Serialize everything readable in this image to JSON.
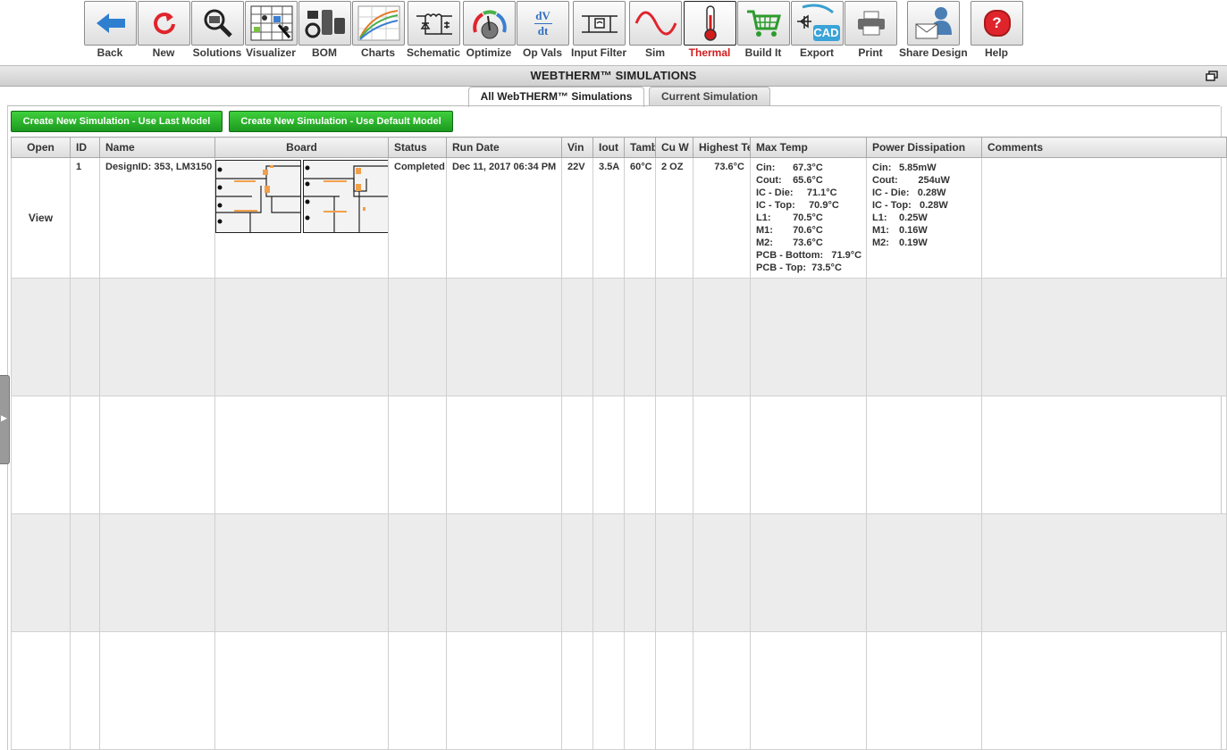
{
  "toolbar": {
    "items": [
      {
        "label": "Back",
        "icon": "back-arrow-icon"
      },
      {
        "label": "New",
        "icon": "refresh-icon"
      },
      {
        "label": "Solutions",
        "icon": "magnifier-icon"
      },
      {
        "label": "Visualizer",
        "icon": "visualizer-grid-icon"
      },
      {
        "label": "BOM",
        "icon": "components-icon"
      },
      {
        "label": "Charts",
        "icon": "chart-curves-icon"
      },
      {
        "label": "Schematic",
        "icon": "schematic-icon"
      },
      {
        "label": "Optimize",
        "icon": "dial-icon"
      },
      {
        "label": "Op Vals",
        "icon": "dv-dt-icon",
        "glyph_top": "dV",
        "glyph_bottom": "dt"
      },
      {
        "label": "Input Filter",
        "icon": "filter-circuit-icon"
      },
      {
        "label": "Sim",
        "icon": "sine-wave-icon"
      },
      {
        "label": "Thermal",
        "icon": "thermometer-icon"
      },
      {
        "label": "Build It",
        "icon": "shopping-cart-icon"
      },
      {
        "label": "Export",
        "icon": "cad-icon",
        "glyph": "CAD"
      },
      {
        "label": "Print",
        "icon": "printer-icon"
      },
      {
        "label": "Share Design",
        "icon": "share-person-icon"
      },
      {
        "label": "Help",
        "icon": "help-icon",
        "glyph": "?"
      }
    ],
    "active": "Thermal",
    "active_color": "#d31c1c"
  },
  "title": "WEBTHERM™ SIMULATIONS",
  "tabs": [
    {
      "label": "All WebTHERM™ Simulations",
      "selected": true
    },
    {
      "label": "Current Simulation",
      "selected": false
    }
  ],
  "buttons": {
    "last_model": "Create New Simulation - Use Last Model",
    "default_model": "Create New Simulation - Use Default Model",
    "color": "#2bb52a"
  },
  "grid": {
    "columns": [
      "Open",
      "ID",
      "Name",
      "Board",
      "Status",
      "Run Date",
      "Vin",
      "Iout",
      "Tamb",
      "Cu W",
      "Highest Te",
      "Max Temp",
      "Power Dissipation",
      "Comments"
    ],
    "rows": [
      {
        "open": "View",
        "id": "1",
        "name": "DesignID: 353, LM3150",
        "status": "Completed",
        "run_date": "Dec 11, 2017 06:34 PM",
        "vin": "22V",
        "iout": "3.5A",
        "tamb": "60°C",
        "cu_weight": "2 OZ",
        "highest_temp": "73.6°C",
        "max_temp": [
          {
            "k": "Cin:",
            "v": "67.3°C"
          },
          {
            "k": "Cout:",
            "v": "65.6°C"
          },
          {
            "k": "IC - Die:",
            "v": "71.1°C"
          },
          {
            "k": "IC - Top:",
            "v": "70.9°C"
          },
          {
            "k": "L1:",
            "v": "70.5°C"
          },
          {
            "k": "M1:",
            "v": "70.6°C"
          },
          {
            "k": "M2:",
            "v": "73.6°C"
          },
          {
            "k": "PCB - Bottom:",
            "v": "71.9°C"
          },
          {
            "k": "PCB - Top:",
            "v": "73.5°C"
          }
        ],
        "power_dissipation": [
          {
            "k": "Cin:",
            "v": "5.85mW"
          },
          {
            "k": "Cout:",
            "v": "254uW"
          },
          {
            "k": "IC - Die:",
            "v": "0.28W"
          },
          {
            "k": "IC - Top:",
            "v": "0.28W"
          },
          {
            "k": "L1:",
            "v": "0.25W"
          },
          {
            "k": "M1:",
            "v": "0.16W"
          },
          {
            "k": "M2:",
            "v": "0.19W"
          }
        ],
        "comments": ""
      }
    ],
    "empty_rows": 4
  }
}
